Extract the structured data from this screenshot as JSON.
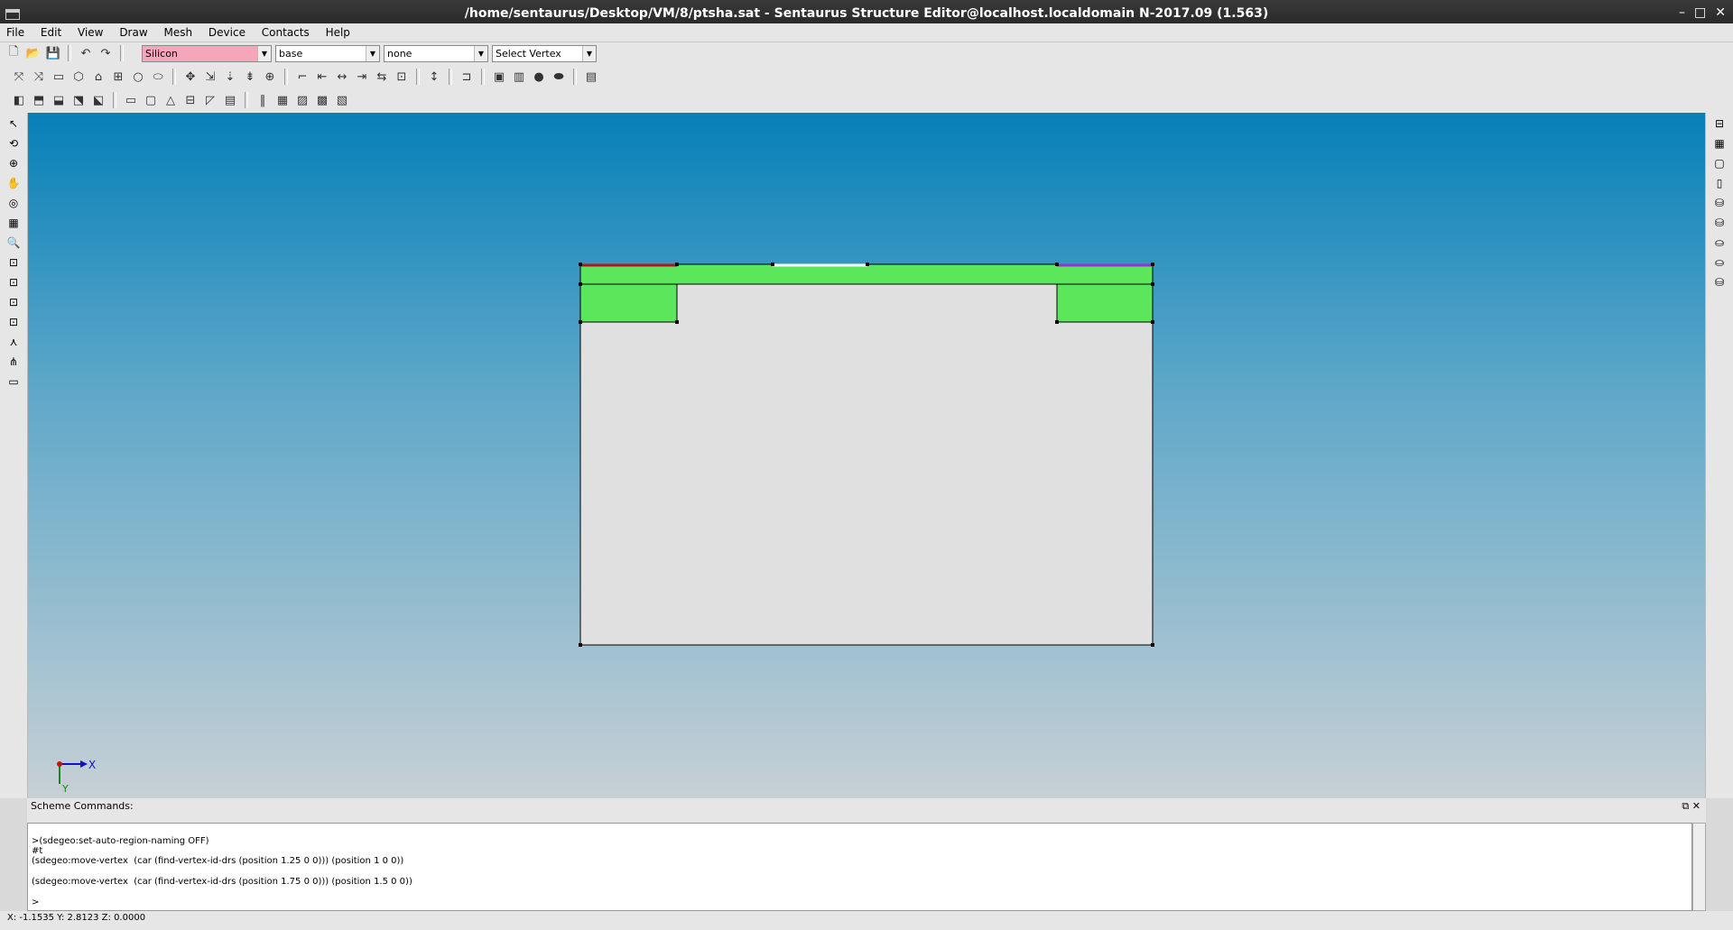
{
  "window": {
    "title": "/home/sentaurus/Desktop/VM/8/ptsha.sat - Sentaurus Structure Editor@localhost.localdomain N-2017.09 (1.563)"
  },
  "menu": [
    "File",
    "Edit",
    "View",
    "Draw",
    "Mesh",
    "Device",
    "Contacts",
    "Help"
  ],
  "toolbar": {
    "material": "Silicon",
    "region": "base",
    "contact": "none",
    "selection": "Select Vertex",
    "material_color": "#f6a6bb"
  },
  "axis": {
    "x_label": "X",
    "y_label": "Y"
  },
  "colors": {
    "region_green": "#5ce65c",
    "bulk_gray": "#e0e0e0",
    "contact_red": "#b01818",
    "contact_purple": "#9b30d0"
  },
  "command_panel": {
    "title": "Scheme Commands:",
    "lines": [
      ">(sdegeo:set-auto-region-naming OFF)",
      "#t",
      "(sdegeo:move-vertex  (car (find-vertex-id-drs (position 1.25 0 0))) (position 1 0 0))",
      "",
      "(sdegeo:move-vertex  (car (find-vertex-id-drs (position 1.75 0 0))) (position 1.5 0 0))",
      "",
      ">"
    ]
  },
  "status": {
    "coords": "X: -1.1535 Y: 2.8123 Z: 0.0000"
  }
}
